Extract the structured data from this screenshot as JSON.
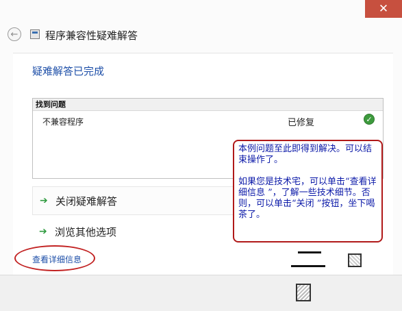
{
  "window": {
    "title": "程序兼容性疑难解答",
    "close_glyph": "✕"
  },
  "header": {
    "back_glyph": "←",
    "heading": "疑难解答已完成"
  },
  "results": {
    "header": "找到问题",
    "rows": [
      {
        "name": "不兼容程序",
        "status": "已修复",
        "status_icon": "checkmark-icon"
      }
    ]
  },
  "options": [
    {
      "label": "关闭疑难解答",
      "icon": "green-arrow-icon"
    },
    {
      "label": "浏览其他选项",
      "icon": "green-arrow-icon"
    }
  ],
  "details_link": "查看详细信息",
  "annotation": {
    "line1": "本例问题至此即得到解决。可以结束操作了。",
    "line2": "如果您是技术宅，可以单击“查看详细信息 ”，了解一些技术细节。否则，可以单击“关闭 ”按钮，坐下喝茶了。"
  },
  "colors": {
    "accent": "#1e4fa8",
    "close": "#c7503f",
    "annotation_border": "#b01818",
    "annotation_text": "#0b19a8",
    "success": "#3d9a3d"
  }
}
